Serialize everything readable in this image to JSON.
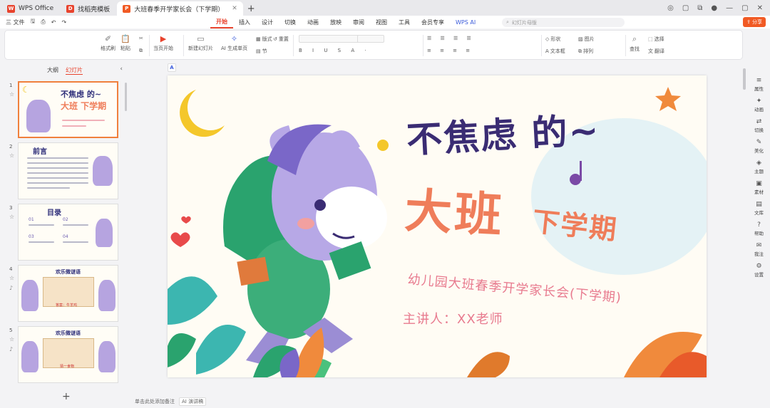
{
  "titlebar": {
    "tabs": [
      {
        "label": "WPS Office",
        "color": "#e8432d",
        "icon_text": "W"
      },
      {
        "label": "找稻壳模板",
        "color": "#e8432d",
        "icon_text": "D"
      },
      {
        "label": "大班春季开学家长会（下学期）",
        "color": "#f15a24",
        "icon_text": "P"
      }
    ],
    "plus": "+",
    "right_icons": [
      "◎",
      "▢",
      "⧉",
      "●",
      "—",
      "▢",
      "✕"
    ]
  },
  "menubar": {
    "file": "三 文件",
    "tabs": [
      "开始",
      "插入",
      "设计",
      "切换",
      "动画",
      "放映",
      "审阅",
      "视图",
      "工具",
      "会员专享",
      "WPS AI"
    ],
    "active_tab": "开始",
    "search_placeholder": "幻灯片母版",
    "share": "分享"
  },
  "ribbon": {
    "format_painter": "格式刷",
    "paste": "粘贴",
    "play": "当页开始",
    "new_slide": "新建幻灯片",
    "ai_slide": "AI 生成单页",
    "layout": "版式",
    "section": "节",
    "reset": "重置",
    "shape": "形状",
    "picture": "图片",
    "textbox": "文本框",
    "arrange": "排列",
    "find": "查找",
    "select": "选择",
    "translate": "翻译"
  },
  "leftpanel": {
    "tabs": [
      "大纲",
      "幻灯片"
    ],
    "active_tab": "幻灯片",
    "slides": [
      {
        "num": "1",
        "title": "不焦虑 的~",
        "title2": "大班 下学期"
      },
      {
        "num": "2",
        "title": "前言"
      },
      {
        "num": "3",
        "title": "目录",
        "items": [
          "01",
          "02",
          "03",
          "04"
        ]
      },
      {
        "num": "4",
        "title": "欢乐微谜语",
        "footer": "答案：牛羊鸡"
      },
      {
        "num": "5",
        "title": "欢乐微谜语",
        "footer": "猜一食物"
      }
    ],
    "add": "+"
  },
  "slide": {
    "title1": "不焦虑 的~",
    "title2": "大班",
    "title3": "下学期",
    "subtitle": "幼儿园大班春季开学家长会(下学期)",
    "presenter": "主讲人：XX老师"
  },
  "rightbar": {
    "items": [
      {
        "icon": "≡",
        "label": "属性"
      },
      {
        "icon": "✦",
        "label": "动画"
      },
      {
        "icon": "⇄",
        "label": "切换"
      },
      {
        "icon": "✎",
        "label": "美化"
      },
      {
        "icon": "◈",
        "label": "主题"
      },
      {
        "icon": "▣",
        "label": "素材"
      },
      {
        "icon": "▤",
        "label": "文库"
      },
      {
        "icon": "?",
        "label": "帮助"
      },
      {
        "icon": "✉",
        "label": "我注"
      },
      {
        "icon": "⚙",
        "label": "设置"
      }
    ]
  },
  "statusbar": {
    "note": "单击此处添加备注",
    "ai": "AI 演讲稿"
  }
}
